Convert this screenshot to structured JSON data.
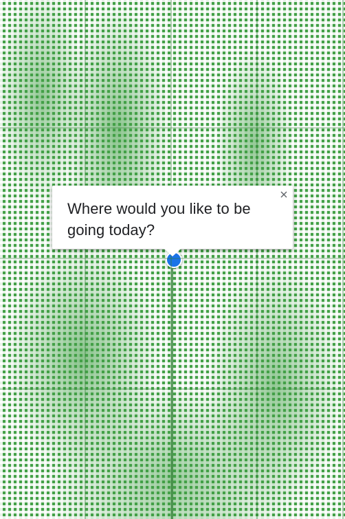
{
  "popup": {
    "question": "Where would you like to be going today?",
    "close_icon": "close-icon"
  },
  "map": {
    "accent_color": "#43a047",
    "marker_color": "#1a73e8",
    "marker_icon": "location-pin-icon"
  }
}
